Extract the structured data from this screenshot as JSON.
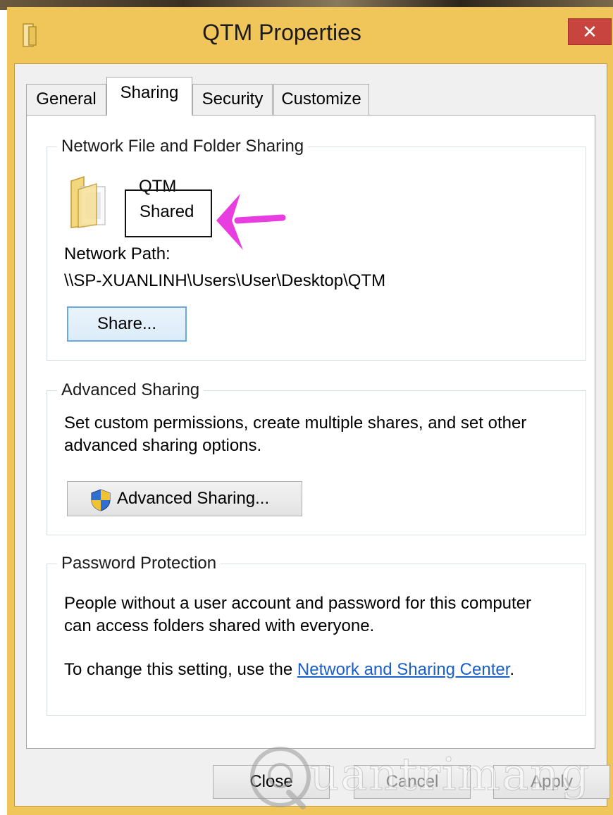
{
  "window": {
    "title": "QTM Properties",
    "close_glyph": "✕"
  },
  "tabs": [
    {
      "label": "General",
      "active": false
    },
    {
      "label": "Sharing",
      "active": true
    },
    {
      "label": "Security",
      "active": false
    },
    {
      "label": "Customize",
      "active": false
    }
  ],
  "network_sharing": {
    "group_title": "Network File and Folder Sharing",
    "folder_name": "QTM",
    "share_status": "Shared",
    "network_path_label": "Network Path:",
    "network_path_value": "\\\\SP-XUANLINH\\Users\\User\\Desktop\\QTM",
    "share_button": "Share..."
  },
  "advanced_sharing": {
    "group_title": "Advanced Sharing",
    "description_line1": "Set custom permissions, create multiple shares, and set other",
    "description_line2": "advanced sharing options.",
    "button": "Advanced Sharing..."
  },
  "password_protection": {
    "group_title": "Password Protection",
    "description_line1": "People without a user account and password for this computer",
    "description_line2": "can access folders shared with everyone.",
    "change_prefix": "To change this setting, use the ",
    "change_link": "Network and Sharing Center",
    "change_suffix": "."
  },
  "footer": {
    "close": "Close",
    "cancel": "Cancel",
    "apply": "Apply"
  },
  "annotation": {
    "arrow_color": "#e83ee0"
  },
  "watermark": {
    "text": "uantrimang"
  },
  "colors": {
    "titlebar": "#f0c65a",
    "close_button": "#c7453e",
    "link": "#1a5fc7"
  }
}
